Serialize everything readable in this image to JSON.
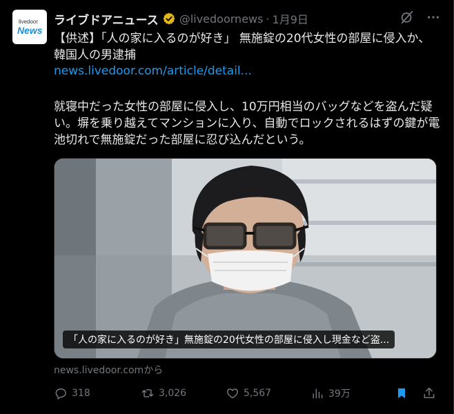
{
  "post": {
    "author": {
      "avatar_top": "livedoor",
      "avatar_bottom": "News",
      "display_name": "ライブドアニュース",
      "handle": "@livedoornews",
      "separator": "·",
      "date": "1月9日"
    },
    "headline": "【供述】「人の家に入るのが好き」 無施錠の20代女性の部屋に侵入か、韓国人の男逮捕",
    "link": "news.livedoor.com/article/detail...",
    "body": "就寝中だった女性の部屋に侵入し、10万円相当のバッグなどを盗んだ疑い。塀を乗り越えてマンションに入り、自動でロックされるはずの鍵が電池切れで無施錠だった部屋に忍び込んだという。",
    "media": {
      "caption": "「人の家に入るのが好き」無施錠の20代女性の部屋に侵入し現金など盗..."
    },
    "source": "news.livedoor.comから",
    "metrics": {
      "replies": "318",
      "reposts": "3,026",
      "likes": "5,567",
      "views": "39万"
    }
  },
  "colors": {
    "background": "#000000",
    "text": "#e7e9ea",
    "muted": "#71767b",
    "link": "#1d9bf0",
    "verified": "#e2b719"
  }
}
